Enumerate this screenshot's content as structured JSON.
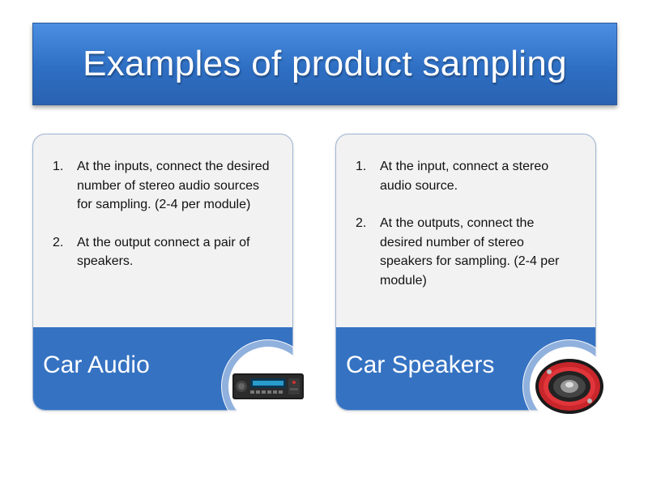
{
  "slide": {
    "title": "Examples of product sampling"
  },
  "cards": [
    {
      "label": "Car Audio",
      "steps": [
        {
          "num": "1.",
          "text": "At the inputs, connect the desired number of stereo audio sources for sampling. (2-4 per module)"
        },
        {
          "num": "2.",
          "text": "At the output connect a pair of speakers."
        }
      ],
      "image_icon": "car-radio-icon"
    },
    {
      "label": "Car Speakers",
      "steps": [
        {
          "num": "1.",
          "text": "At the input, connect a stereo audio source."
        },
        {
          "num": "2.",
          "text": "At the outputs, connect the desired number of stereo speakers for sampling. (2-4 per module)"
        }
      ],
      "image_icon": "car-speaker-icon"
    }
  ],
  "colors": {
    "banner_blue": "#2e6fc4",
    "footer_blue": "#3572c2",
    "card_bg": "#f2f2f2",
    "speaker_red": "#c8262b"
  }
}
